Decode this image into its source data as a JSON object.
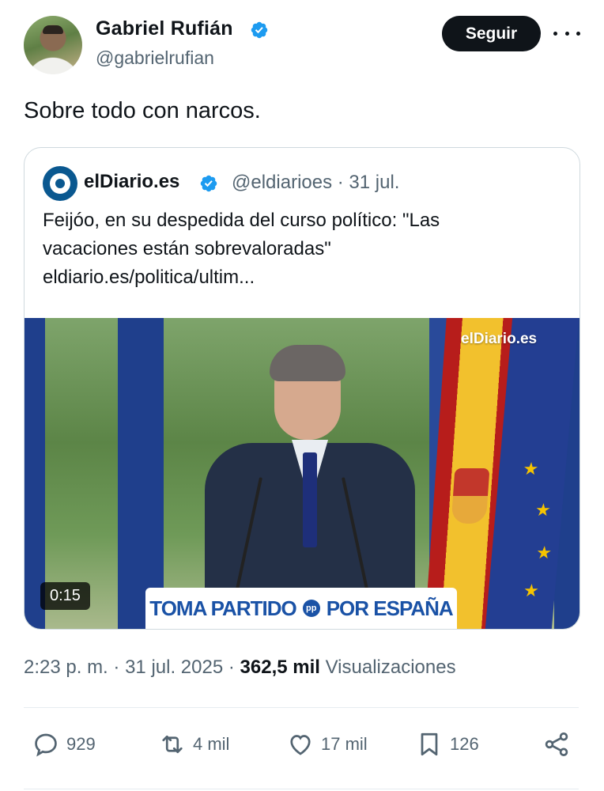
{
  "author": {
    "name": "Gabriel Rufián",
    "handle": "@gabrielrufian",
    "follow_label": "Seguir"
  },
  "tweet": {
    "text": "Sobre todo con narcos."
  },
  "quoted": {
    "name": "elDiario.es",
    "meta": "@eldiarioes · 31 jul.",
    "lines": [
      "Feijóo, en su despedida del curso político: \"Las",
      "vacaciones están sobrevaloradas\"",
      "eldiario.es/politica/ultim..."
    ],
    "media": {
      "watermark": "elDiario.es",
      "duration": "0:15",
      "podium_left": "TOMA PARTIDO",
      "podium_badge": "pp",
      "podium_right": "POR ESPAÑA"
    }
  },
  "stats": {
    "time": "2:23 p. m.",
    "date": "31 jul. 2025",
    "views": "362,5 mil",
    "views_label": "Visualizaciones"
  },
  "actions": {
    "replies": "929",
    "reposts": "4 mil",
    "likes": "17 mil",
    "bookmarks": "126"
  },
  "colors": {
    "text": "#0f1419",
    "secondary": "#536471",
    "verified": "#1d9bf0",
    "border": "#cfd9de"
  }
}
